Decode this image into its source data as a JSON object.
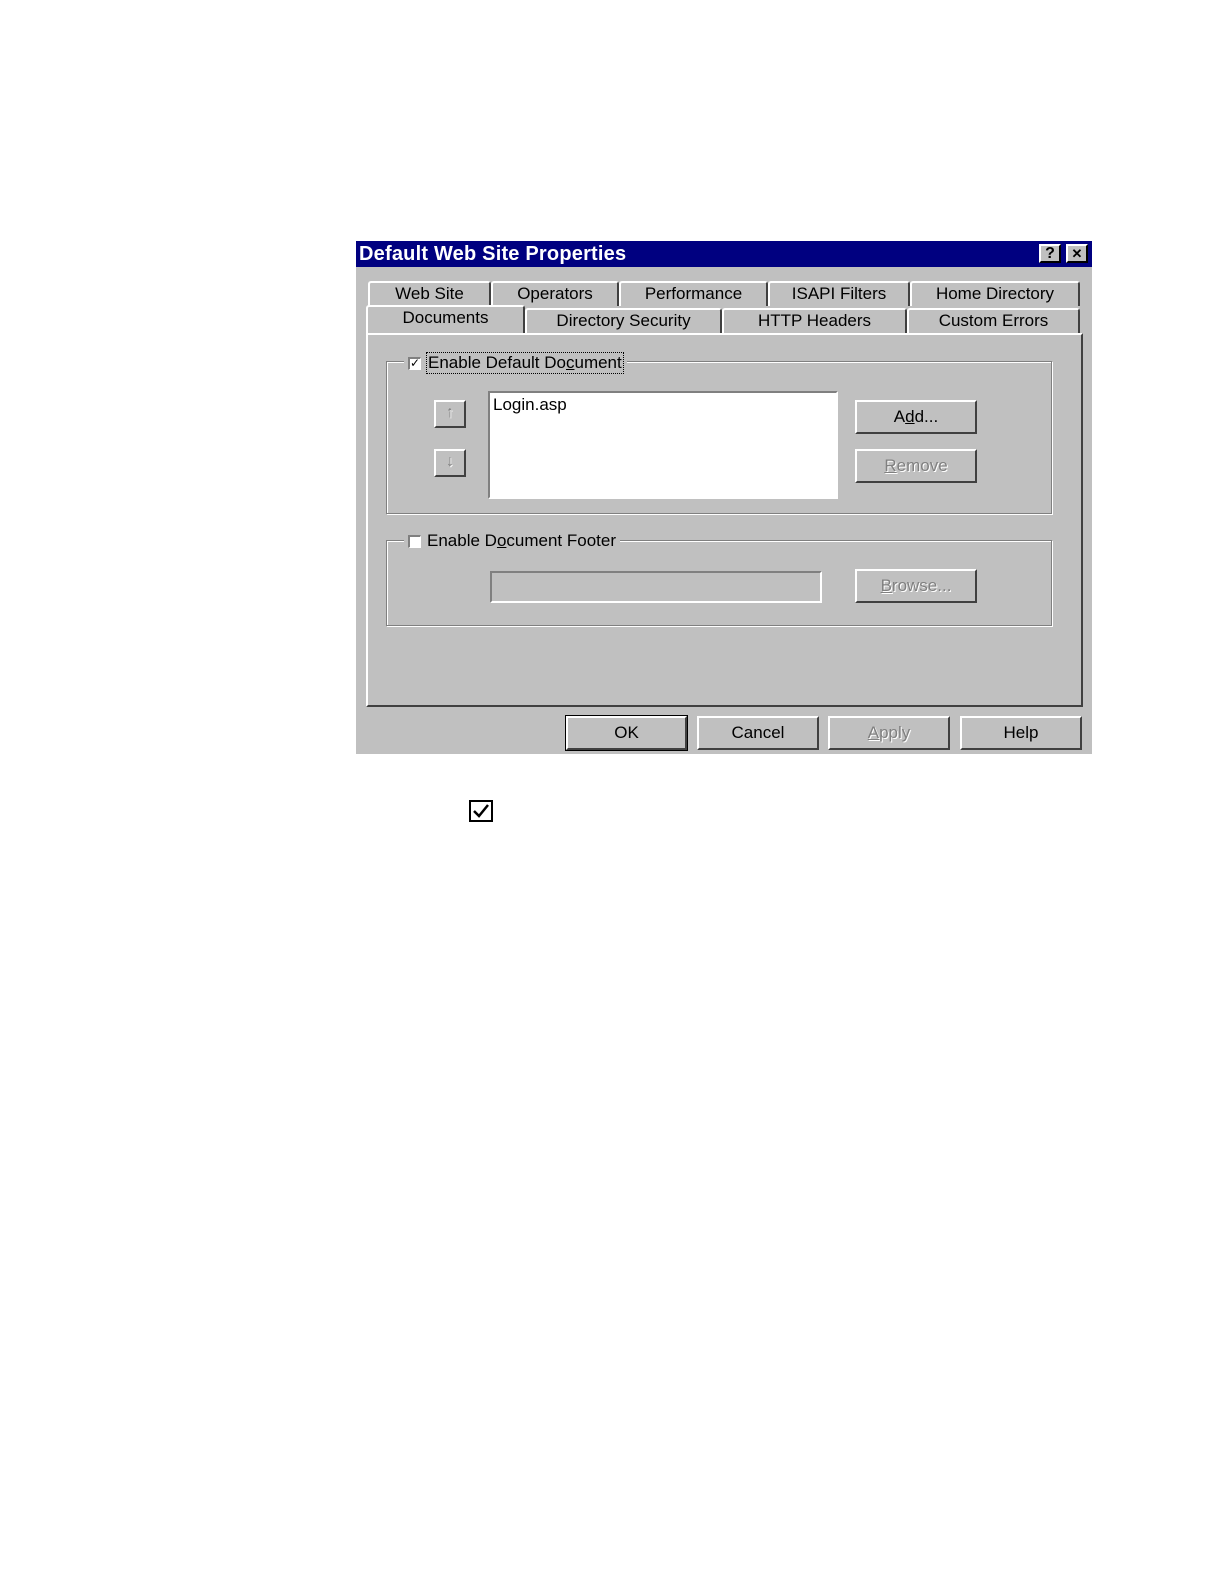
{
  "window": {
    "title": "Default Web Site Properties",
    "help_glyph": "?",
    "close_glyph": "✕"
  },
  "tabs_row_back": [
    {
      "label": "Web Site"
    },
    {
      "label": "Operators"
    },
    {
      "label": "Performance"
    },
    {
      "label": "ISAPI Filters"
    },
    {
      "label": "Home Directory"
    }
  ],
  "tabs_row_front": [
    {
      "label": "Documents",
      "active": true
    },
    {
      "label": "Directory Security"
    },
    {
      "label": "HTTP Headers"
    },
    {
      "label": "Custom Errors"
    }
  ],
  "default_document": {
    "checkbox_label_pre": "Enable Default Do",
    "checkbox_label_accel": "c",
    "checkbox_label_post": "ument",
    "checked": true,
    "check_glyph": "✓",
    "list_items": [
      "Login.asp"
    ],
    "move_up_glyph": "↑",
    "move_down_glyph": "↓",
    "add_label_pre": "A",
    "add_label_accel": "d",
    "add_label_post": "d...",
    "remove_label_accel": "R",
    "remove_label_post": "emove"
  },
  "document_footer": {
    "checkbox_label_pre": "Enable D",
    "checkbox_label_accel": "o",
    "checkbox_label_post": "cument Footer",
    "checked": false,
    "path_value": "",
    "browse_label_accel": "B",
    "browse_label_post": "rowse..."
  },
  "footer_buttons": {
    "ok": "OK",
    "cancel": "Cancel",
    "apply_accel": "A",
    "apply_post": "pply",
    "help": "Help"
  },
  "standalone_check_glyph": "✓"
}
